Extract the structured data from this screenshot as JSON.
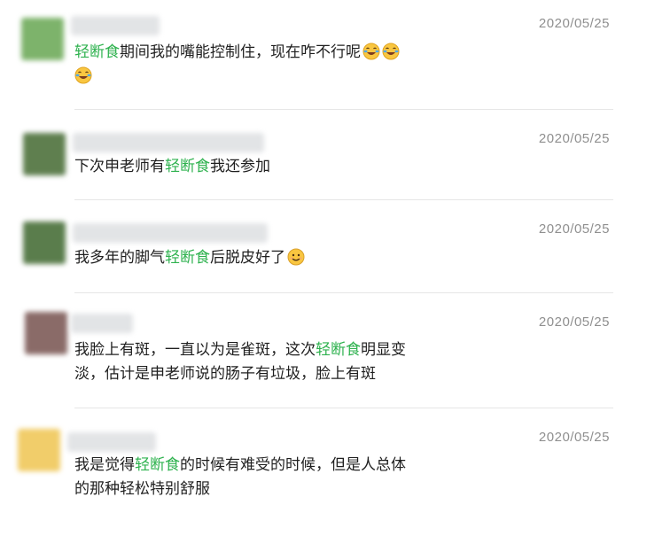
{
  "comments": [
    {
      "date": "2020/05/25",
      "avatar_color": "#7db36b",
      "keyword": "轻断食",
      "text_before": "",
      "text_after": "期间我的嘴能控制住，现在咋不行呢",
      "line2": "",
      "emojis": [
        "crying-laughing-emoji",
        "crying-laughing-emoji",
        "crying-laughing-emoji"
      ]
    },
    {
      "date": "2020/05/25",
      "avatar_color": "#5f7f4f",
      "text_before": "下次申老师有",
      "keyword": "轻断食",
      "text_after": "我还参加"
    },
    {
      "date": "2020/05/25",
      "avatar_color": "#5a7d4c",
      "text_before": "我多年的脚气",
      "keyword": "轻断食",
      "text_after": "后脱皮好了",
      "emojis": [
        "smiling-face-emoji"
      ]
    },
    {
      "date": "2020/05/25",
      "avatar_color": "#8a6b68",
      "text_before": "我脸上有斑，一直以为是雀斑，这次",
      "keyword": "轻断食",
      "text_after": "明显变",
      "line2": "淡，估计是申老师说的肠子有垃圾，脸上有斑"
    },
    {
      "date": "2020/05/25",
      "avatar_color": "#f1cd6a",
      "text_before": "我是觉得",
      "keyword": "轻断食",
      "text_after": "的时候有难受的时候，但是人总体",
      "line2": "的那种轻松特别舒服"
    }
  ],
  "colors": {
    "highlight": "#2fb24f",
    "date": "#8f8f8f",
    "divider": "#e6e6e6"
  }
}
